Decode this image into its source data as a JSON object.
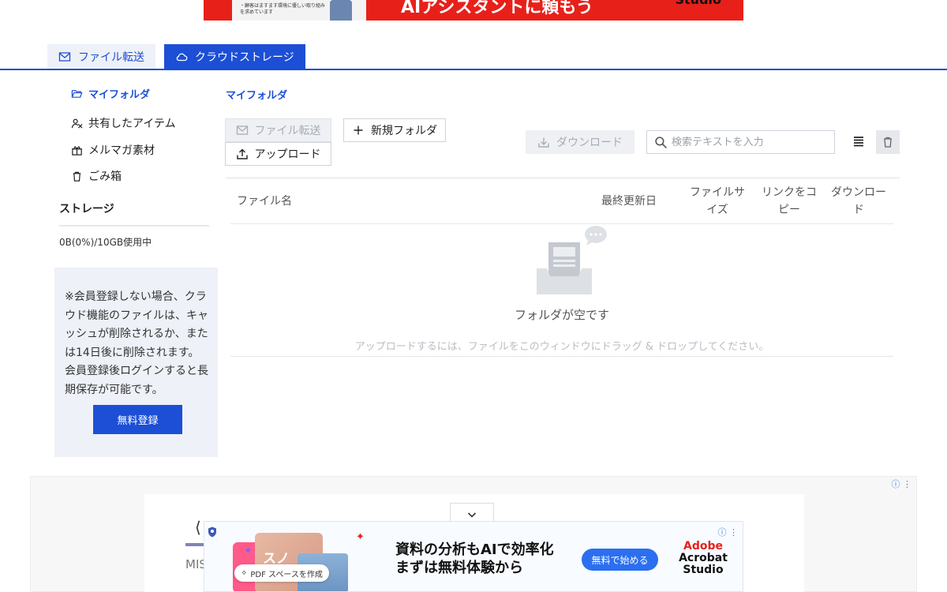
{
  "top_ad": {
    "thumb_line1": "・顧客はますます環境に優しい取り組み",
    "thumb_line2": "を求めています",
    "headline": "AIアシスタントに頼もう",
    "brand": "Studio"
  },
  "tabs": [
    {
      "label": "ファイル転送",
      "icon": "mail-icon",
      "active": false
    },
    {
      "label": "クラウドストレージ",
      "icon": "cloud-icon",
      "active": true
    }
  ],
  "sidebar": {
    "items": [
      {
        "label": "マイフォルダ",
        "icon": "folder-open-icon"
      },
      {
        "label": "共有したアイテム",
        "icon": "shared-users-icon"
      },
      {
        "label": "メルマガ素材",
        "icon": "gift-icon"
      },
      {
        "label": "ごみ箱",
        "icon": "trash-icon"
      }
    ],
    "storage_title": "ストレージ",
    "storage_usage": "0B(0%)/10GB使用中",
    "notice": "※会員登録しない場合、クラウド機能のファイルは、キャッシュが削除されるか、または14日後に削除されます。会員登録後ログインすると長期保存が可能です。",
    "signup_label": "無料登録"
  },
  "main": {
    "folder_title": "マイフォルダ",
    "toolbar": {
      "file_transfer_label": "ファイル転送",
      "new_folder_label": "新規フォルダ",
      "upload_label": "アップロード",
      "download_label": "ダウンロード",
      "search_placeholder": "検索テキストを入力"
    },
    "columns": {
      "name": "ファイル名",
      "modified": "最終更新日",
      "size": "ファイルサイズ",
      "copy_link": "リンクをコピー",
      "download": "ダウンロード"
    },
    "empty_title": "フォルダが空です",
    "empty_hint": "アップロードするには、ファイルをこのウィンドウにドラッグ & ドロップしてください。"
  },
  "bottom_ad": {
    "inner_text": "MIS",
    "pink_text": "スノ",
    "pill_label": "PDF スペースを作成",
    "headline_line1": "資料の分析もAIで効率化",
    "headline_line2": "まずは無料体験から",
    "cta_label": "無料で始める",
    "brand_line1": "Adobe",
    "brand_line2": "Acrobat",
    "brand_line3": "Studio"
  },
  "colors": {
    "accent": "#1c4fd6",
    "tab_inactive_bg": "#eef1f7",
    "ad_red": "#e8201a"
  }
}
